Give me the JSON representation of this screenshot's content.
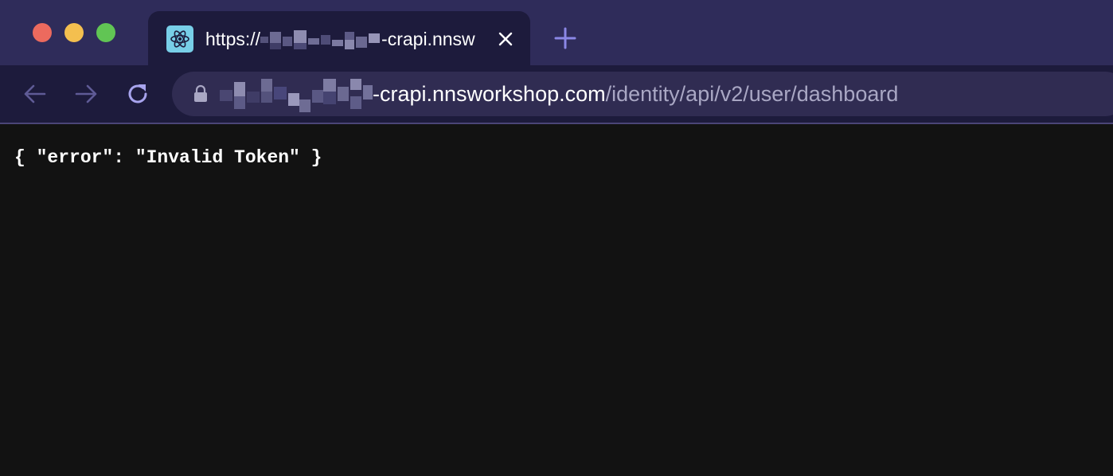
{
  "window_controls": {
    "close": "close-window",
    "minimize": "minimize-window",
    "zoom": "zoom-window"
  },
  "tab": {
    "title_prefix": "https://",
    "title_suffix": "-crapi.nnsw",
    "favicon": "react-logo-icon",
    "close_icon": "close-icon"
  },
  "toolbar": {
    "back_icon": "arrow-left-icon",
    "forward_icon": "arrow-right-icon",
    "reload_icon": "reload-icon",
    "new_tab_icon": "plus-icon"
  },
  "address_bar": {
    "lock_icon": "lock-icon",
    "host": "-crapi.nnsworkshop.com",
    "path": "/identity/api/v2/user/dashboard"
  },
  "page": {
    "body": "{ \"error\": \"Invalid Token\" }"
  },
  "colors": {
    "tabstrip": "#2f2c5a",
    "toolbar": "#1d1b3c",
    "omnibox": "#302c52",
    "page_background": "#121212",
    "accent": "#8b87e6"
  }
}
